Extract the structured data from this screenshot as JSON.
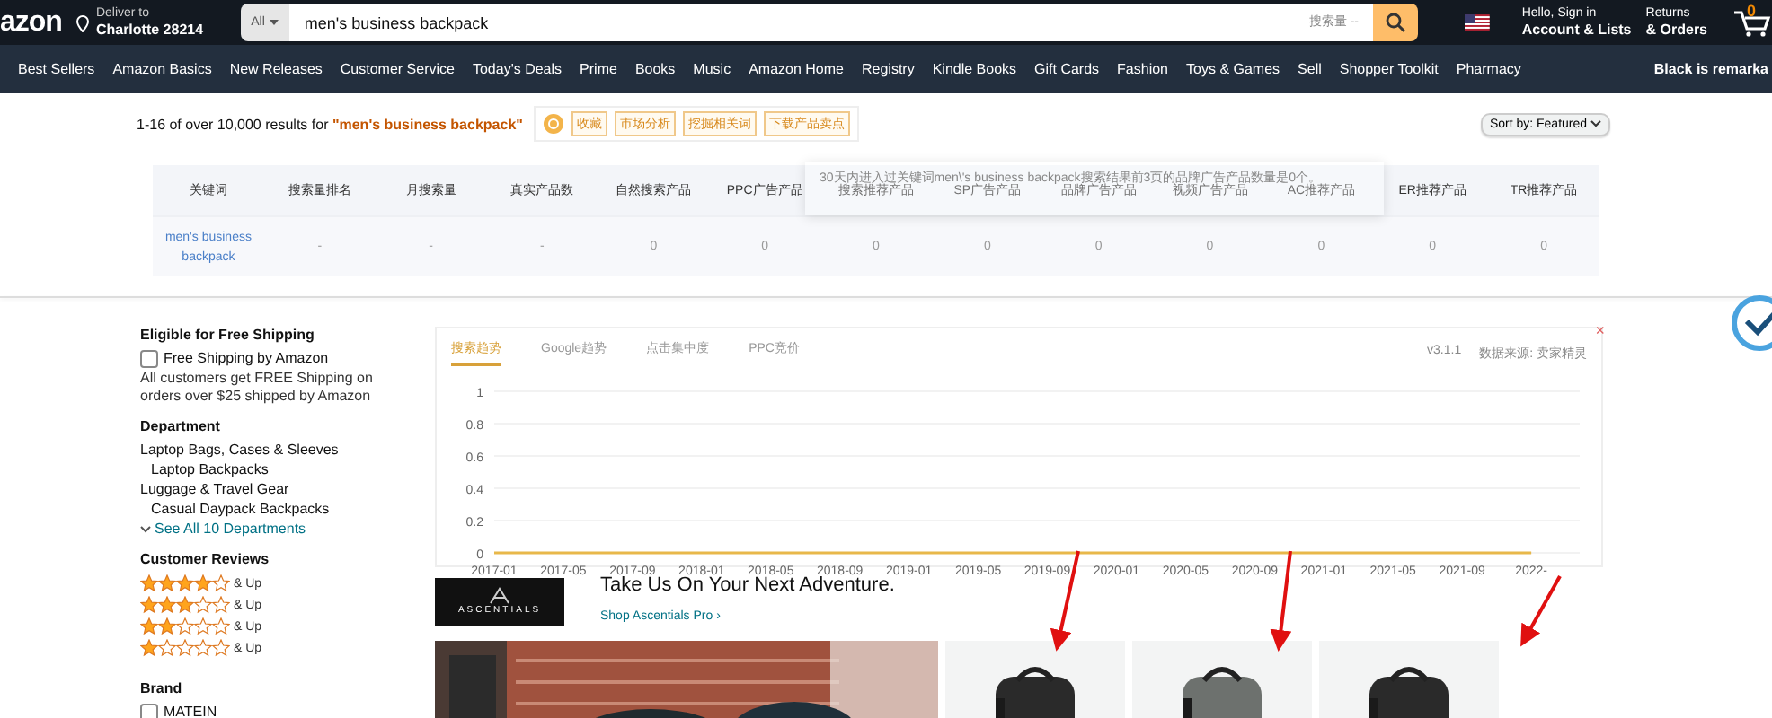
{
  "header": {
    "logo": "azon",
    "deliver_label": "Deliver to",
    "deliver_place": "Charlotte 28214",
    "search_scope": "All",
    "search_value": "men's business backpack",
    "search_volume": "搜索量 --",
    "greeting": "Hello, Sign in",
    "account": "Account & Lists",
    "returns": "Returns",
    "orders": "& Orders",
    "cart_count": "0"
  },
  "nav": [
    "Best Sellers",
    "Amazon Basics",
    "New Releases",
    "Customer Service",
    "Today's Deals",
    "Prime",
    "Books",
    "Music",
    "Amazon Home",
    "Registry",
    "Kindle Books",
    "Gift Cards",
    "Fashion",
    "Toys & Games",
    "Sell",
    "Shopper Toolkit",
    "Pharmacy"
  ],
  "nav_promo": "Black is remarka",
  "results": {
    "text": "1-16 of over 10,000 results for **\"men's business backpack\"**",
    "tools": [
      "收藏",
      "市场分析",
      "挖掘相关词",
      "下载产品卖点"
    ],
    "sort_label": "Sort by:",
    "sort_value": "Featured"
  },
  "keyword_table": {
    "columns": [
      "关键词",
      "搜索量排名",
      "月搜索量",
      "真实产品数",
      "自然搜索产品",
      "PPC广告产品",
      "搜索推荐产品",
      "SP广告产品",
      "品牌广告产品",
      "视频广告产品",
      "AC推荐产品",
      "ER推荐产品",
      "TR推荐产品"
    ],
    "rows": [
      [
        "men's business backpack",
        "-",
        "-",
        "-",
        "0",
        "0",
        "0",
        "0",
        "0",
        "0",
        "0",
        "0",
        "0"
      ]
    ],
    "tooltip": "30天内进入过关键词men\\'s business backpack搜索结果前3页的品牌广告产品数量是0个。"
  },
  "sidebar": [
    {
      "kind": "checkbox",
      "title": "Eligible for Free Shipping",
      "label": "Free Shipping by Amazon",
      "checked": false,
      "note": "All customers get FREE Shipping on orders over $25 shipped by Amazon"
    },
    {
      "kind": "links",
      "title": "Department",
      "items": [
        {
          "label": "Laptop Bags, Cases & Sleeves",
          "children": [
            {
              "label": "Laptop Backpacks"
            }
          ]
        },
        {
          "label": "Luggage & Travel Gear",
          "children": [
            {
              "label": "Casual Daypack Backpacks"
            }
          ]
        }
      ],
      "more": "See All 10 Departments"
    },
    {
      "kind": "stars",
      "title": "Customer Reviews",
      "items": [
        {
          "stars": 4,
          "label": "& Up"
        },
        {
          "stars": 3,
          "label": "& Up"
        },
        {
          "stars": 2,
          "label": "& Up"
        },
        {
          "stars": 1,
          "label": "& Up"
        }
      ]
    },
    {
      "kind": "brands",
      "title": "Brand",
      "items": [
        {
          "label": "MATEIN",
          "checked": false
        }
      ]
    }
  ],
  "trend_panel": {
    "tabs": [
      {
        "label": "搜索趋势",
        "selected": true
      },
      {
        "label": "Google趋势",
        "selected": false
      },
      {
        "label": "点击集中度",
        "selected": false
      },
      {
        "label": "PPC竞价",
        "selected": false
      }
    ],
    "version": "v3.1.1",
    "source": "数据来源: 卖家精灵",
    "close": "×",
    "chart_data": {
      "type": "line",
      "categories": [
        "2017-01",
        "2017-05",
        "2017-09",
        "2018-01",
        "2018-05",
        "2018-09",
        "2019-01",
        "2019-05",
        "2019-09",
        "2020-01",
        "2020-05",
        "2020-09",
        "2021-01",
        "2021-05",
        "2021-09",
        "2022-"
      ],
      "series": [
        {
          "color": "#e8b84a",
          "values": [
            0,
            0,
            0,
            0,
            0,
            0,
            0,
            0,
            0,
            0,
            0,
            0,
            0,
            0,
            0,
            0
          ]
        }
      ],
      "ylim": [
        0,
        1
      ],
      "yticks": [
        0,
        0.2,
        0.4,
        0.6,
        0.8,
        1
      ],
      "grid": true
    }
  },
  "sponsored": {
    "brand": "ASCENTIALS",
    "headline": "Take Us On Your Next Adventure.",
    "link": "Shop Ascentials Pro ›"
  }
}
